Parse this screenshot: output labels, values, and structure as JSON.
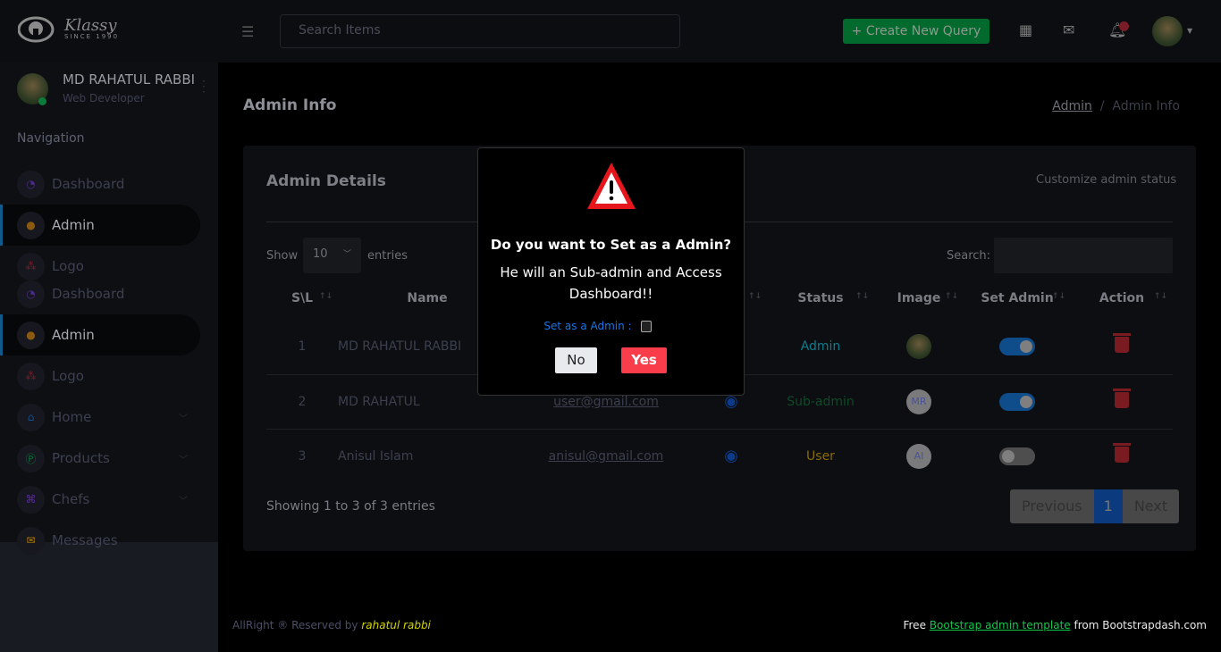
{
  "brand": {
    "name": "Klassy",
    "since": "SINCE 1990"
  },
  "topbar": {
    "search_placeholder": "Search Items",
    "create_label": "+ Create New Query"
  },
  "profile": {
    "name": "MD RAHATUL RABBI",
    "role": "Web Developer"
  },
  "nav": {
    "title": "Navigation",
    "items": [
      {
        "label": "Dashboard"
      },
      {
        "label": "Admin"
      },
      {
        "label": "Logo"
      },
      {
        "label": "Dashboard"
      },
      {
        "label": "Admin"
      },
      {
        "label": "Logo"
      },
      {
        "label": "Home"
      },
      {
        "label": "Products"
      },
      {
        "label": "Chefs"
      },
      {
        "label": "Messages"
      }
    ]
  },
  "page": {
    "title": "Admin Info",
    "breadcrumb": [
      "Admin",
      "Admin Info"
    ]
  },
  "card": {
    "title": "Admin Details",
    "description": "Customize admin status",
    "show": "Show",
    "entries_value": "10",
    "entries": "entries",
    "search_label": "Search:"
  },
  "table": {
    "headers": [
      "S\\L",
      "Name",
      "",
      "",
      "Status",
      "Image",
      "Set Admin",
      "Action"
    ],
    "rows": [
      {
        "sl": "1",
        "name": "MD RAHATUL RABBI",
        "email": "",
        "status": "Admin",
        "status_color": "#0c7d8f",
        "image": "photo",
        "set_admin": true
      },
      {
        "sl": "2",
        "name": "MD RAHATUL",
        "email": "user@gmail.com",
        "status": "Sub-admin",
        "status_color": "#0e4a28",
        "image": "MR",
        "set_admin": true
      },
      {
        "sl": "3",
        "name": "Anisul Islam",
        "email": "anisul@gmail.com",
        "status": "User",
        "status_color": "#8a6b00",
        "image": "AI",
        "set_admin": false
      }
    ]
  },
  "pagination": {
    "info": "Showing 1 to 3 of 3 entries",
    "previous": "Previous",
    "current": "1",
    "next": "Next"
  },
  "modal": {
    "question": "Do you want to Set as a Admin?",
    "message": "He will an Sub-admin and Access Dashboard!!",
    "checkbox_label": "Set as a Admin :",
    "checked": false,
    "no": "No",
    "yes": "Yes"
  },
  "footer": {
    "left_prefix": "AllRight ® Reserved by",
    "left_author": "rahatul rabbi",
    "right_prefix": "Free",
    "right_link": "Bootstrap admin template",
    "right_suffix": "from Bootstrapdash.com"
  }
}
